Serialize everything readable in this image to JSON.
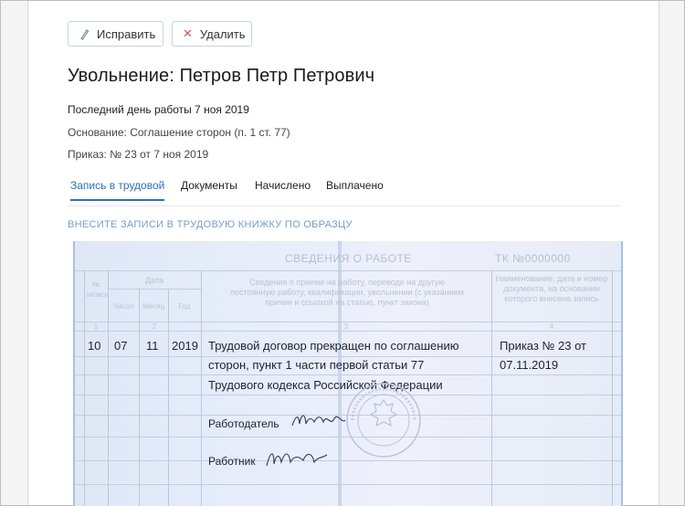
{
  "toolbar": {
    "edit_label": "Исправить",
    "delete_label": "Удалить",
    "edit_icon": "pencil-icon",
    "delete_icon": "close-icon"
  },
  "header": {
    "title": "Увольнение: Петров Петр Петрович",
    "last_day": "Последний день работы 7 ноя 2019",
    "basis": "Основание: Соглашение сторон (п. 1 ст. 77)",
    "order": "Приказ: № 23 от 7 ноя 2019"
  },
  "tabs": [
    {
      "label": "Запись в трудовой",
      "active": true
    },
    {
      "label": "Документы",
      "active": false
    },
    {
      "label": "Начислено",
      "active": false
    },
    {
      "label": "Выплачено",
      "active": false
    }
  ],
  "hint": "ВНЕСИТЕ ЗАПИСИ В ТРУДОВУЮ КНИЖКУ ПО ОБРАЗЦУ",
  "book": {
    "title": "СВЕДЕНИЯ О РАБОТЕ",
    "tk_number": "ТК №0000000",
    "col_num": "№ записи",
    "col_date": "Дата",
    "col_day": "Число",
    "col_month": "Месяц",
    "col_year": "Год",
    "col_info": "Сведения о приеме на работу, переводе на другую постоянную работу, квалификации, увольнении (с указанием причин и ссылкой на статью, пункт закона)",
    "col_doc": "Наименование, дата и номер документа, на основании которого внесена запись",
    "col_idx_1": "1",
    "col_idx_2": "2",
    "col_idx_3": "3",
    "col_idx_4": "4",
    "entry": {
      "number": "10",
      "day": "07",
      "month": "11",
      "year": "2019",
      "text_line1": "Трудовой договор прекращен по соглашению",
      "text_line2": "сторон, пункт 1 части первой статьи 77",
      "text_line3": "Трудового кодекса Российской Федерации",
      "doc_line1": "Приказ № 23 от",
      "doc_line2": "07.11.2019"
    },
    "employer_label": "Работодатель",
    "employee_label": "Работник"
  },
  "colors": {
    "accent": "#2f6fb7",
    "delete": "#e24b5b",
    "hint": "#7a9cc4"
  }
}
